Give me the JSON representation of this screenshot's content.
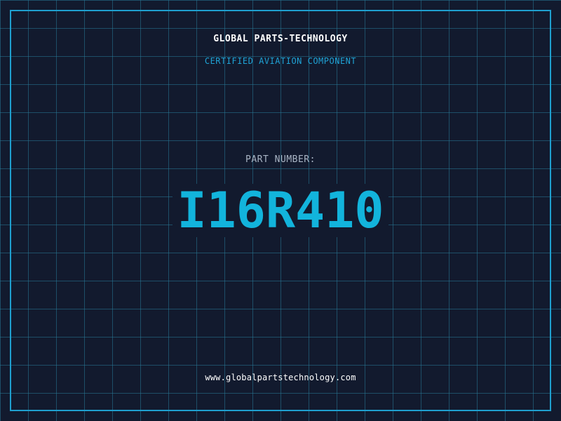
{
  "header": {
    "brand": "GLOBAL PARTS-TECHNOLOGY",
    "subtitle": "CERTIFIED AVIATION COMPONENT"
  },
  "part": {
    "label": "PART NUMBER:",
    "number": "I16R410"
  },
  "footer": {
    "website": "www.globalpartstechnology.com"
  },
  "colors": {
    "background": "#121a2e",
    "grid": "#28788f",
    "frame": "#1f9fcf",
    "accent": "#12b4dc",
    "brand_text": "#ffffff",
    "label_text": "#a8b4c4"
  }
}
